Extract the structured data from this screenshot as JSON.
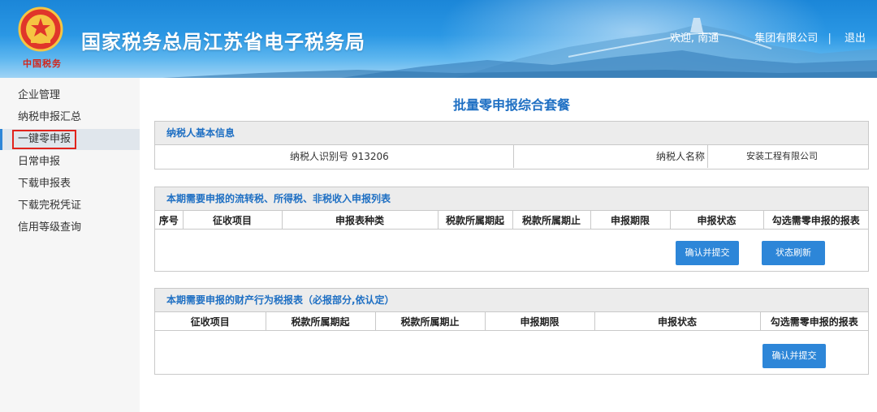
{
  "header": {
    "site_title": "国家税务总局江苏省电子税务局",
    "emblem_caption": "中国税务",
    "welcome": "欢迎, 南通",
    "company": "集团有限公司",
    "separator": "|",
    "logout": "退出"
  },
  "sidebar": {
    "items": [
      {
        "label": "企业管理"
      },
      {
        "label": "纳税申报汇总"
      },
      {
        "label": "一键零申报"
      },
      {
        "label": "日常申报"
      },
      {
        "label": "下载申报表"
      },
      {
        "label": "下载完税凭证"
      },
      {
        "label": "信用等级查询"
      }
    ],
    "active_index": 2
  },
  "main": {
    "page_title": "批量零申报综合套餐",
    "taxpayer_info": {
      "heading": "纳税人基本信息",
      "id_label": "纳税人识别号",
      "id_value": "913206",
      "name_label": "纳税人名称",
      "name_value": "安装工程有限公司"
    },
    "circulation_tax": {
      "heading": "本期需要申报的流转税、所得税、非税收入申报列表",
      "columns": [
        "序号",
        "征收项目",
        "申报表种类",
        "税款所属期起",
        "税款所属期止",
        "申报期限",
        "申报状态",
        "勾选需零申报的报表"
      ],
      "confirm_button": "确认并提交",
      "refresh_button": "状态刷新"
    },
    "property_tax": {
      "heading": "本期需要申报的财产行为税报表（必报部分,依认定）",
      "columns": [
        "征收项目",
        "税款所属期起",
        "税款所属期止",
        "申报期限",
        "申报状态",
        "勾选需零申报的报表"
      ],
      "confirm_button": "确认并提交"
    }
  },
  "colors": {
    "accent_blue": "#2d86d8",
    "title_blue": "#1e6fc3",
    "highlight_red": "#e1231c"
  }
}
